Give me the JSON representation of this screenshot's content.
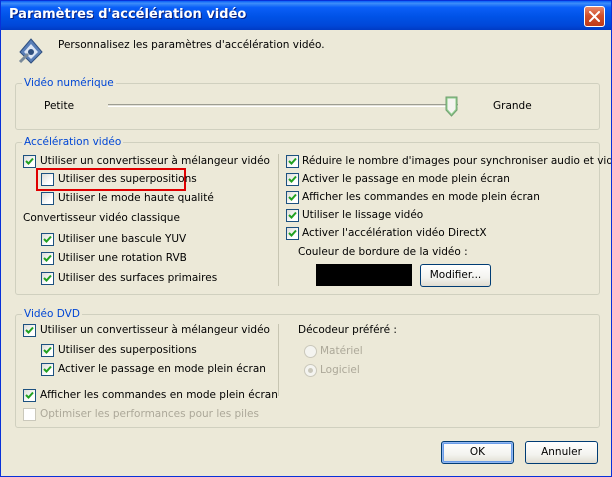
{
  "window": {
    "title": "Paramètres d'accélération vidéo",
    "description": "Personnalisez les paramètres d'accélération vidéo.",
    "icons": {
      "app": "video-settings-icon",
      "close": "close-icon"
    }
  },
  "digital_video": {
    "legend": "Vidéo numérique",
    "slider_min_label": "Petite",
    "slider_max_label": "Grande",
    "slider_level_fraction": 1.0
  },
  "video_acceleration": {
    "legend": "Accélération vidéo",
    "use_mixer": {
      "label": "Utiliser un convertisseur à mélangeur vidéo",
      "checked": true
    },
    "use_overlays": {
      "label": "Utiliser des superpositions",
      "checked": false,
      "highlighted": true
    },
    "high_quality": {
      "label": "Utiliser le mode haute qualité",
      "checked": false
    },
    "classic_heading": "Convertisseur vidéo classique",
    "yuv_flip": {
      "label": "Utiliser une bascule YUV",
      "checked": true
    },
    "rgb_rotation": {
      "label": "Utiliser une rotation RVB",
      "checked": true
    },
    "primary_surfaces": {
      "label": "Utiliser des surfaces primaires",
      "checked": true
    },
    "reduce_frames": {
      "label": "Réduire le nombre d'images pour synchroniser audio et vidéo",
      "checked": true
    },
    "fullscreen_switch": {
      "label": "Activer le passage en mode plein écran",
      "checked": true
    },
    "fullscreen_controls": {
      "label": "Afficher les commandes en mode plein écran",
      "checked": true
    },
    "video_smoothing": {
      "label": "Utiliser le lissage vidéo",
      "checked": true
    },
    "directx": {
      "label": "Activer l'accélération vidéo DirectX",
      "checked": true
    },
    "border_color_label": "Couleur de bordure de la vidéo :",
    "border_color": "#000000",
    "modify_button": "Modifier..."
  },
  "dvd_video": {
    "legend": "Vidéo DVD",
    "use_mixer": {
      "label": "Utiliser un convertisseur à mélangeur vidéo",
      "checked": true
    },
    "use_overlays": {
      "label": "Utiliser des superpositions",
      "checked": true
    },
    "fullscreen_switch": {
      "label": "Activer le passage en mode plein écran",
      "checked": true
    },
    "fullscreen_controls": {
      "label": "Afficher les commandes en mode plein écran",
      "checked": true
    },
    "optimize_files": {
      "label": "Optimiser les performances pour les piles",
      "checked": false,
      "disabled": true
    },
    "decoder_heading": "Décodeur préféré :",
    "hardware": {
      "label": "Matériel",
      "selected": false,
      "disabled": true
    },
    "software": {
      "label": "Logiciel",
      "selected": true,
      "disabled": true
    }
  },
  "buttons": {
    "ok": "OK",
    "cancel": "Annuler"
  },
  "colors": {
    "titlebar": "#0a5ff8",
    "dialog_background": "#ece9d8",
    "legend_text": "#0046d5",
    "highlight": "#e00000",
    "check_mark": "#21a121"
  }
}
